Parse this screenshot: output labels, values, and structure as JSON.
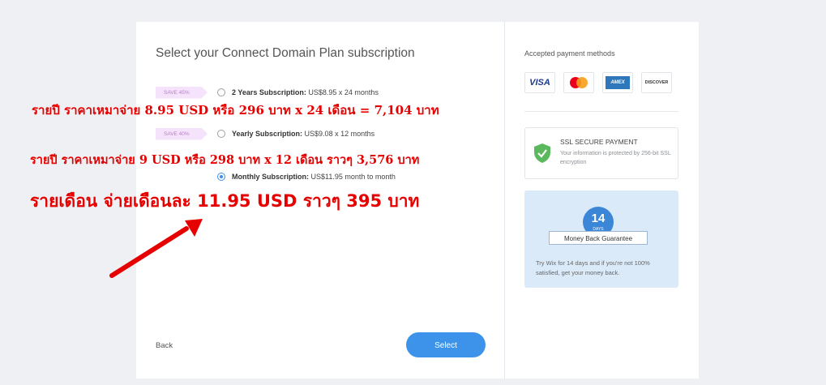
{
  "plan_panel": {
    "title": "Select your Connect Domain Plan subscription",
    "options": [
      {
        "badge": "SAVE 45%",
        "name": "2 Years Subscription:",
        "price": "US$8.95 x 24 months",
        "selected": false
      },
      {
        "badge": "SAVE 40%",
        "name": "Yearly Subscription:",
        "price": "US$9.08 x 12 months",
        "selected": false
      },
      {
        "badge": "",
        "name": "Monthly Subscription:",
        "price": "US$11.95 month to month",
        "selected": true
      }
    ],
    "back_label": "Back",
    "select_label": "Select"
  },
  "annotations": {
    "two_year": "รายปี ราคาเหมาจ่าย 8.95 USD หรือ 296 บาท x 24 เดือน = 7,104 บาท",
    "yearly": "รายปี ราคาเหมาจ่าย 9 USD หรือ 298 บาท x 12 เดือน ราวๆ 3,576 บาท",
    "monthly": "รายเดือน จ่ายเดือนละ 11.95 USD ราวๆ 395 บาท"
  },
  "payment_panel": {
    "title": "Accepted payment methods",
    "cards": [
      {
        "name": "VISA",
        "icon": "visa-card-icon"
      },
      {
        "name": "Mastercard",
        "icon": "mastercard-card-icon"
      },
      {
        "name": "AMEX",
        "icon": "amex-card-icon"
      },
      {
        "name": "DISCOVER",
        "icon": "discover-card-icon"
      }
    ],
    "ssl": {
      "title": "SSL SECURE PAYMENT",
      "description": "Your information is protected by 256-bit SSL encryption"
    },
    "guarantee": {
      "days": "14",
      "days_label": "DAYS",
      "ribbon": "Money Back Guarantee",
      "description": "Try Wix for 14 days and if you're not 100% satisfied, get your money back."
    }
  },
  "colors": {
    "accent": "#3d93ea",
    "annotation": "#e60000",
    "badge_text": "#c07bd6",
    "badge_bg": "#f4e3fa"
  }
}
